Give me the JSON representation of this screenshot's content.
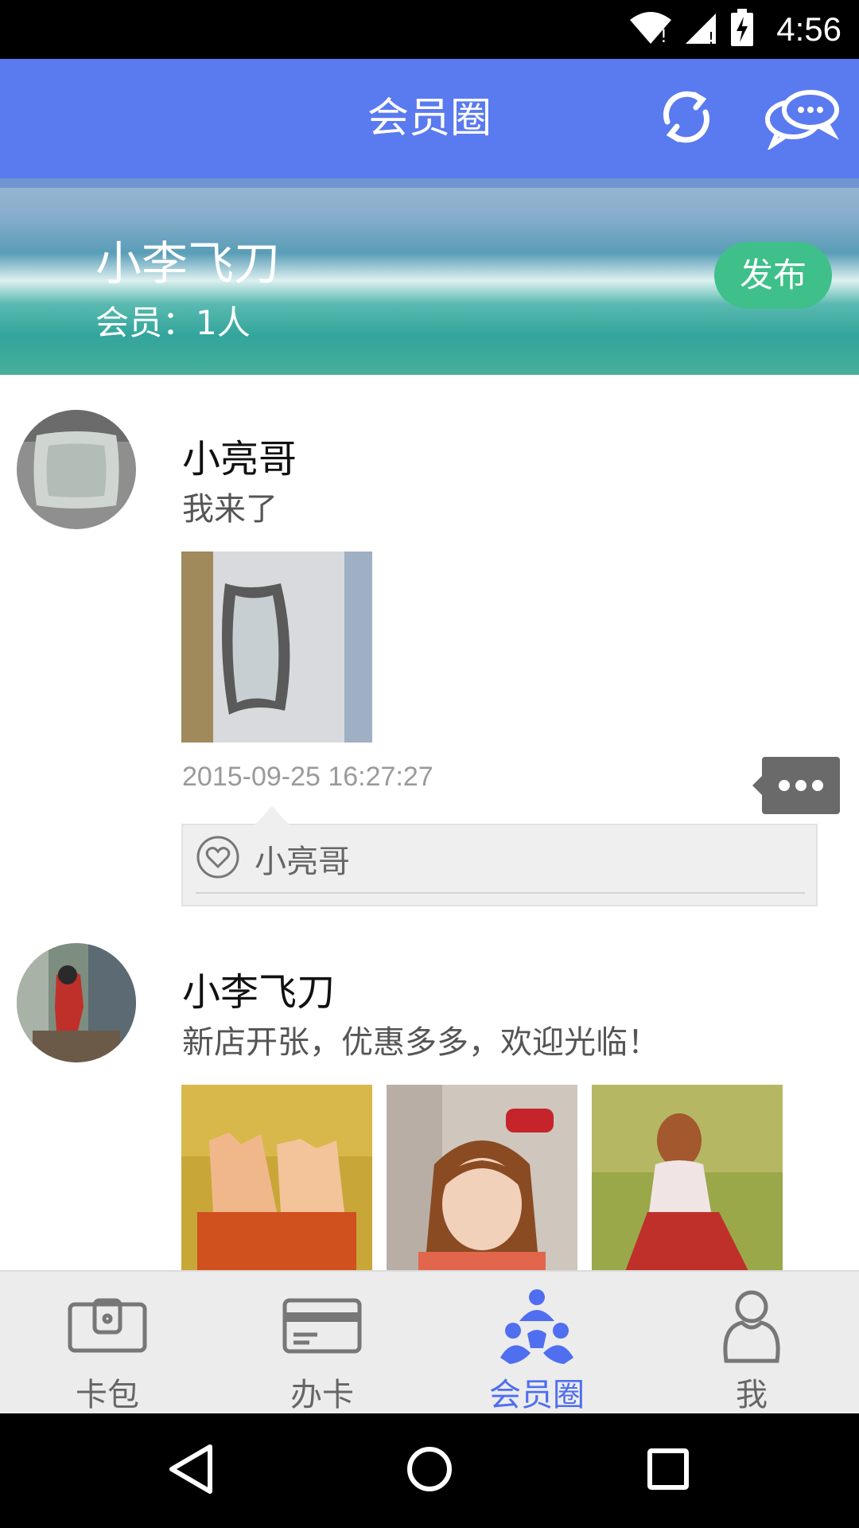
{
  "status_bar": {
    "time": "4:56",
    "icons": [
      "wifi-icon",
      "signal-icon",
      "battery-icon"
    ]
  },
  "header": {
    "title": "会员圈",
    "actions": [
      "refresh-icon",
      "chat-icon"
    ],
    "color": "#5a7af0"
  },
  "banner": {
    "group_name": "小李飞刀",
    "member_count": "会员：1人",
    "publish_label": "发布",
    "publish_color": "#3fbf8a"
  },
  "posts": [
    {
      "author": "小亮哥",
      "text": "我来了",
      "image_count": 1,
      "timestamp": "2015-09-25 16:27:27",
      "likes": [
        "小亮哥"
      ]
    },
    {
      "author": "小李飞刀",
      "text": "新店开张，优惠多多，欢迎光临！",
      "image_count": 3
    }
  ],
  "bottom_nav": {
    "items": [
      {
        "label": "卡包",
        "icon": "wallet-icon"
      },
      {
        "label": "办卡",
        "icon": "card-icon"
      },
      {
        "label": "会员圈",
        "icon": "member-circle-icon"
      },
      {
        "label": "我",
        "icon": "profile-icon"
      }
    ],
    "active": "会员圈",
    "active_color": "#4f6ef0"
  },
  "system_nav": [
    "back-icon",
    "home-icon",
    "recents-icon"
  ]
}
